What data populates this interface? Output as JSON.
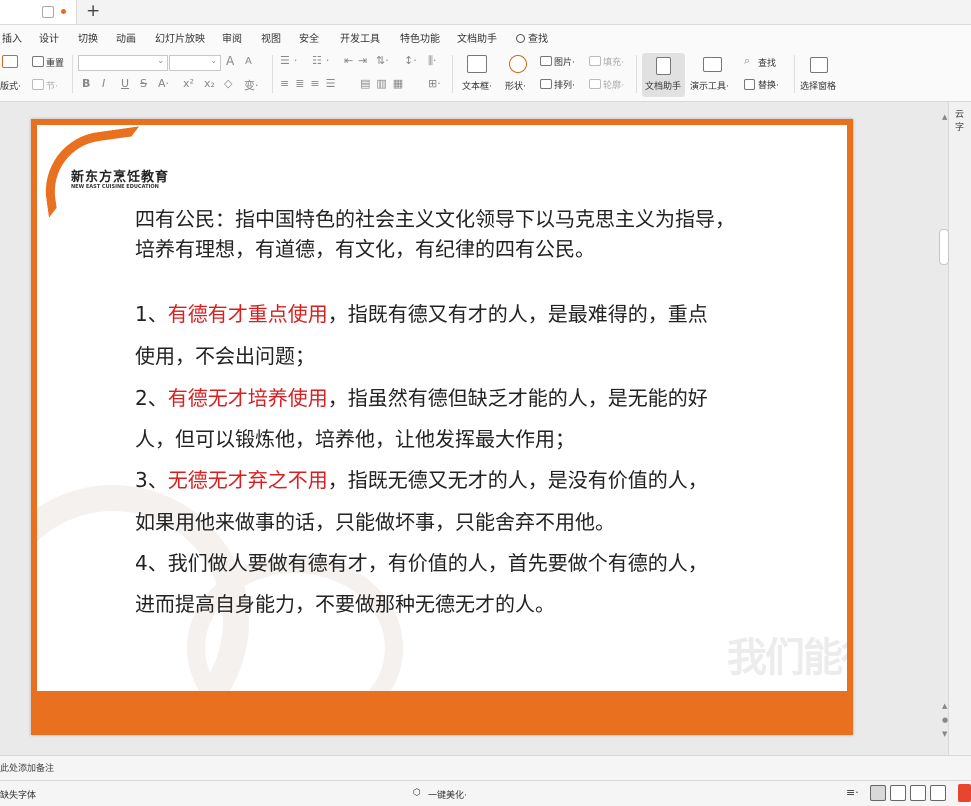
{
  "tabs": {
    "new_tab": "+"
  },
  "menu": {
    "items": [
      "插入",
      "设计",
      "切换",
      "动画",
      "幻灯片放映",
      "审阅",
      "视图",
      "安全",
      "开发工具",
      "特色功能",
      "文档助手",
      "查找"
    ]
  },
  "ribbon": {
    "layout": "版式·",
    "reset": "重置",
    "section": "节·",
    "font_buttons": [
      "B",
      "I",
      "U",
      "S",
      "A·",
      "x²",
      "x₂",
      "◇",
      "变·"
    ],
    "font_size_buttons": [
      "A",
      "A"
    ],
    "textbox": "文本框·",
    "shape": "形状·",
    "picture": "图片·",
    "fill": "填充·",
    "arrange": "排列·",
    "outline": "轮廓·",
    "doc_helper": "文档助手",
    "present_tool": "演示工具·",
    "find": "查找",
    "replace": "替换·",
    "select_pane": "选择窗格"
  },
  "right_pane": {
    "label": "云字"
  },
  "slide": {
    "logo_cn": "新东方烹饪教育",
    "logo_en": "NEW EAST CUISINE EDUCATION",
    "watermark": "我们能行",
    "intro_line1": "四有公民：指中国特色的社会主义文化领导下以马克思主义为指导，",
    "intro_line2": "培养有理想，有道德，有文化，有纪律的四有公民。",
    "p1_prefix": "1、",
    "p1_highlight": "有德有才重点使用",
    "p1_rest": "，指既有德又有才的人，是最难得的，重点",
    "p1_line2": "使用，不会出问题；",
    "p2_prefix": "2、",
    "p2_highlight": "有德无才培养使用",
    "p2_rest": "，指虽然有德但缺乏才能的人，是无能的好",
    "p2_line2": "人，但可以锻炼他，培养他，让他发挥最大作用；",
    "p3_prefix": "3、",
    "p3_highlight": "无德无才弃之不用",
    "p3_rest": "，指既无德又无才的人，是没有价值的人，",
    "p3_line2": "如果用他来做事的话，只能做坏事，只能舍弃不用他。",
    "p4_line1": "4、我们做人要做有德有才，有价值的人，首先要做个有德的人，",
    "p4_line2": "进而提高自身能力，不要做那种无德无才的人。"
  },
  "notes": {
    "placeholder": "此处添加备注"
  },
  "status": {
    "missing_font": "缺失字体",
    "beautify": "一键美化·"
  },
  "colors": {
    "accent": "#e8701e",
    "highlight": "#d81e1e"
  }
}
